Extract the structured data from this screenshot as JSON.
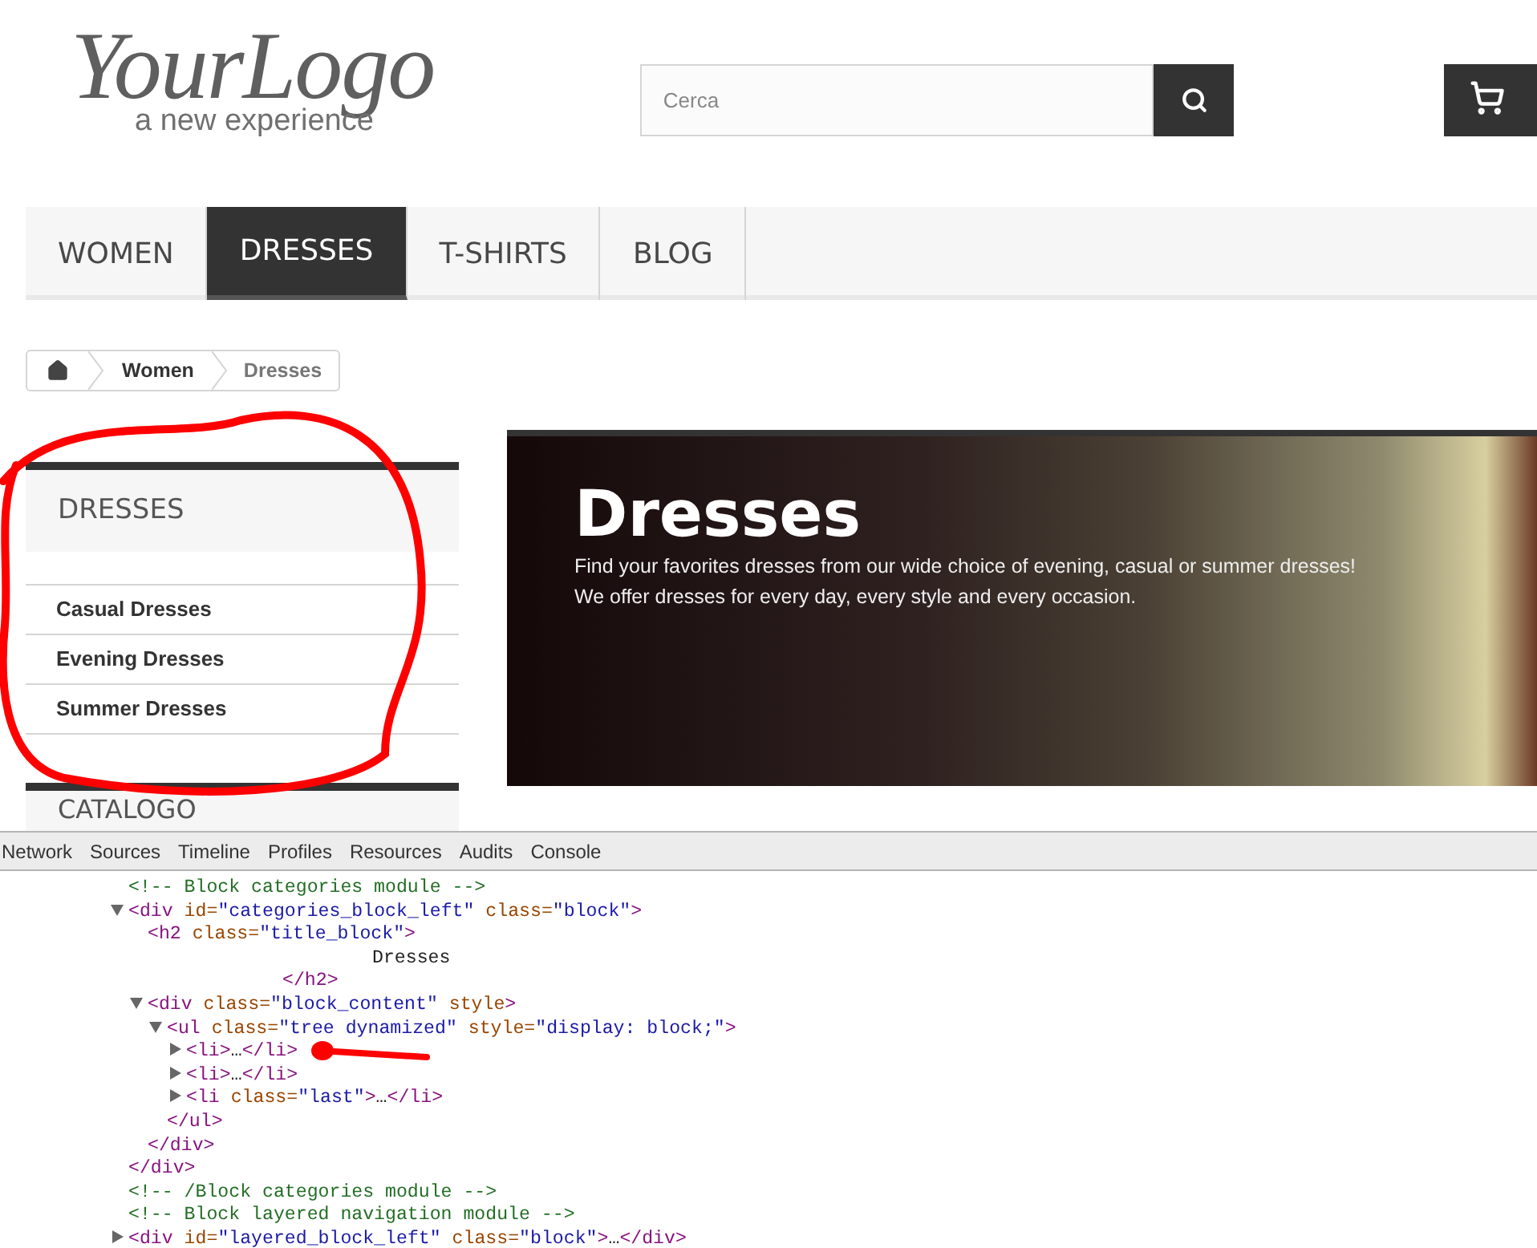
{
  "logo": {
    "wordmark": "YourLogo",
    "tagline": "a new experience"
  },
  "search": {
    "placeholder": "Cerca"
  },
  "nav": [
    {
      "label": "WOMEN",
      "selected": false
    },
    {
      "label": "DRESSES",
      "selected": true
    },
    {
      "label": "T-SHIRTS",
      "selected": false
    },
    {
      "label": "BLOG",
      "selected": false
    }
  ],
  "breadcrumb": [
    {
      "label": "Women",
      "kind": "link"
    },
    {
      "label": "Dresses",
      "kind": "current"
    }
  ],
  "sidebar": {
    "title": "DRESSES",
    "items": [
      "Casual Dresses",
      "Evening Dresses",
      "Summer Dresses"
    ],
    "next_title": "CATALOGO"
  },
  "banner": {
    "title": "Dresses",
    "lines": [
      "Find your favorites dresses from our wide choice of evening, casual or summer dresses!",
      "We offer dresses for every day, every style and every occasion."
    ]
  },
  "devtools": {
    "tabs": [
      {
        "label": "Network",
        "selected": false
      },
      {
        "label": "Sources",
        "selected": false
      },
      {
        "label": "Timeline",
        "selected": false
      },
      {
        "label": "Profiles",
        "selected": false
      },
      {
        "label": "Resources",
        "selected": false
      },
      {
        "label": "Audits",
        "selected": false
      },
      {
        "label": "Console",
        "selected": false
      }
    ],
    "tree": [
      {
        "tokens": [
          {
            "kind": "comment",
            "text": "<!-- Block categories module -->"
          }
        ]
      },
      {
        "expanded": true,
        "tokens": [
          {
            "kind": "tag",
            "text": "<div"
          },
          {
            "kind": "attr",
            "text": " id="
          },
          {
            "kind": "value",
            "text": "\"categories_block_left\""
          },
          {
            "kind": "attr",
            "text": " class="
          },
          {
            "kind": "value",
            "text": "\"block\""
          },
          {
            "kind": "tag",
            "text": ">"
          }
        ],
        "children": [
          {
            "tokens": [
              {
                "kind": "tag",
                "text": "<h2"
              },
              {
                "kind": "attr",
                "text": " class="
              },
              {
                "kind": "value",
                "text": "\"title_block\""
              },
              {
                "kind": "tag",
                "text": ">"
              }
            ],
            "children": [
              {
                "kind": "text",
                "tokens": [
                  {
                    "kind": "text",
                    "text": "Dresses"
                  }
                ]
              }
            ],
            "close": "</h2>"
          },
          {
            "expanded": true,
            "tokens": [
              {
                "kind": "tag",
                "text": "<div"
              },
              {
                "kind": "attr",
                "text": " class="
              },
              {
                "kind": "value",
                "text": "\"block_content\""
              },
              {
                "kind": "attr",
                "text": " style"
              },
              {
                "kind": "tag",
                "text": ">"
              }
            ],
            "children": [
              {
                "expanded": true,
                "tokens": [
                  {
                    "kind": "tag",
                    "text": "<ul"
                  },
                  {
                    "kind": "attr",
                    "text": " class="
                  },
                  {
                    "kind": "value",
                    "text": "\"tree dynamized\""
                  },
                  {
                    "kind": "attr",
                    "text": " style="
                  },
                  {
                    "kind": "value",
                    "text": "\"display: block;\""
                  },
                  {
                    "kind": "tag",
                    "text": ">"
                  }
                ],
                "children": [
                  {
                    "expanded": false,
                    "tokens": [
                      {
                        "kind": "tag",
                        "text": "<li>"
                      },
                      {
                        "kind": "text",
                        "text": "…"
                      },
                      {
                        "kind": "tag",
                        "text": "</li>"
                      }
                    ]
                  },
                  {
                    "expanded": false,
                    "tokens": [
                      {
                        "kind": "tag",
                        "text": "<li>"
                      },
                      {
                        "kind": "text",
                        "text": "…"
                      },
                      {
                        "kind": "tag",
                        "text": "</li>"
                      }
                    ]
                  },
                  {
                    "expanded": false,
                    "tokens": [
                      {
                        "kind": "tag",
                        "text": "<li"
                      },
                      {
                        "kind": "attr",
                        "text": " class="
                      },
                      {
                        "kind": "value",
                        "text": "\"last\""
                      },
                      {
                        "kind": "tag",
                        "text": ">"
                      },
                      {
                        "kind": "text",
                        "text": "…"
                      },
                      {
                        "kind": "tag",
                        "text": "</li>"
                      }
                    ]
                  }
                ],
                "close": "</ul>"
              }
            ],
            "close": "</div>"
          }
        ],
        "close": "</div>"
      },
      {
        "tokens": [
          {
            "kind": "comment",
            "text": "<!-- /Block categories module -->"
          }
        ]
      },
      {
        "tokens": [
          {
            "kind": "comment",
            "text": "<!-- Block layered navigation module -->"
          }
        ]
      },
      {
        "expanded": false,
        "tokens": [
          {
            "kind": "tag",
            "text": "<div"
          },
          {
            "kind": "attr",
            "text": " id="
          },
          {
            "kind": "value",
            "text": "\"layered_block_left\""
          },
          {
            "kind": "attr",
            "text": " class="
          },
          {
            "kind": "value",
            "text": "\"block\""
          },
          {
            "kind": "tag",
            "text": ">"
          },
          {
            "kind": "text",
            "text": "…"
          },
          {
            "kind": "tag",
            "text": "</div>"
          }
        ]
      }
    ]
  }
}
